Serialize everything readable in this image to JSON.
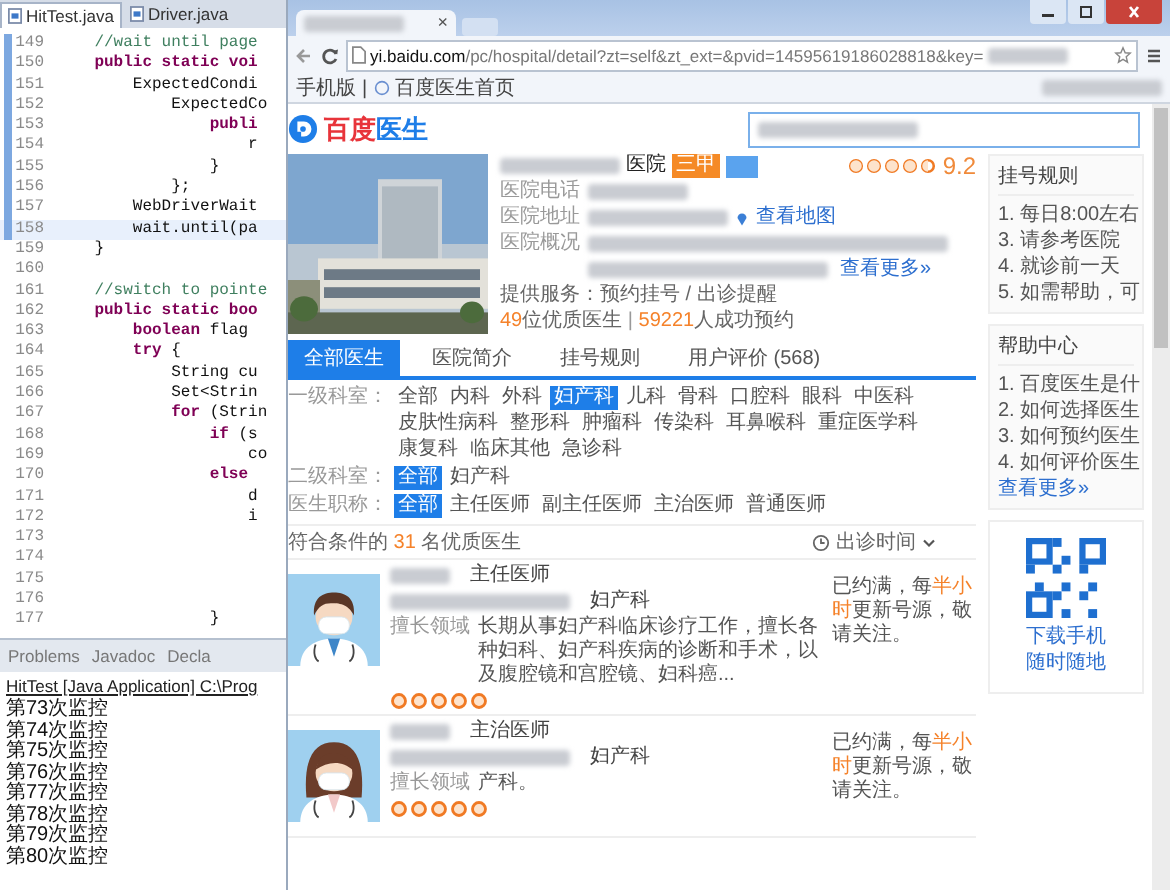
{
  "editor": {
    "tabs": [
      {
        "label": "HitTest.java",
        "selected": true
      },
      {
        "label": "Driver.java",
        "selected": false
      }
    ],
    "lines": [
      {
        "number": "149",
        "current": false,
        "tokens": [
          {
            "text": "    //wait until page",
            "kind": "comment"
          }
        ]
      },
      {
        "number": "150",
        "current": false,
        "tokens": [
          {
            "text": "    public static voi",
            "kind": "keyword"
          }
        ]
      },
      {
        "number": "151",
        "current": false,
        "tokens": [
          {
            "text": "        ExpectedCondi",
            "kind": "plain"
          }
        ]
      },
      {
        "number": "152",
        "current": false,
        "tokens": [
          {
            "text": "            ExpectedCo",
            "kind": "plain"
          }
        ]
      },
      {
        "number": "153",
        "current": false,
        "tokens": [
          {
            "text": "                publi",
            "kind": "keyword"
          }
        ]
      },
      {
        "number": "154",
        "current": false,
        "tokens": [
          {
            "text": "                    r",
            "kind": "plain"
          }
        ]
      },
      {
        "number": "155",
        "current": false,
        "tokens": [
          {
            "text": "                }",
            "kind": "plain"
          }
        ]
      },
      {
        "number": "156",
        "current": false,
        "tokens": [
          {
            "text": "            };",
            "kind": "plain"
          }
        ]
      },
      {
        "number": "157",
        "current": false,
        "tokens": [
          {
            "text": "        WebDriverWait",
            "kind": "plain"
          }
        ]
      },
      {
        "number": "158",
        "current": true,
        "tokens": [
          {
            "text": "        wait.until(pa",
            "kind": "plain"
          }
        ]
      },
      {
        "number": "159",
        "current": false,
        "tokens": [
          {
            "text": "    }",
            "kind": "plain"
          }
        ]
      },
      {
        "number": "160",
        "current": false
      },
      {
        "number": "161",
        "current": false,
        "tokens": [
          {
            "text": "    //switch to pointe",
            "kind": "comment"
          }
        ]
      },
      {
        "number": "162",
        "current": false,
        "tokens": [
          {
            "text": "    public static boo",
            "kind": "keyword"
          }
        ]
      },
      {
        "number": "163",
        "current": false,
        "tokens": [
          {
            "text": "        boolean",
            "kind": "keyword"
          },
          {
            "text": " flag",
            "kind": "plain"
          }
        ]
      },
      {
        "number": "164",
        "current": false,
        "tokens": [
          {
            "text": "        try",
            "kind": "keyword"
          },
          {
            "text": " {",
            "kind": "plain"
          }
        ]
      },
      {
        "number": "165",
        "current": false,
        "tokens": [
          {
            "text": "            String cu",
            "kind": "plain"
          }
        ]
      },
      {
        "number": "166",
        "current": false,
        "tokens": [
          {
            "text": "            Set<Strin",
            "kind": "plain"
          }
        ]
      },
      {
        "number": "167",
        "current": false,
        "tokens": [
          {
            "text": "            for",
            "kind": "keyword"
          },
          {
            "text": " (Strin",
            "kind": "plain"
          }
        ]
      },
      {
        "number": "168",
        "current": false,
        "tokens": [
          {
            "text": "                if",
            "kind": "keyword"
          },
          {
            "text": " (s",
            "kind": "plain"
          }
        ]
      },
      {
        "number": "169",
        "current": false,
        "tokens": [
          {
            "text": "                    co",
            "kind": "plain"
          }
        ]
      },
      {
        "number": "170",
        "current": false,
        "tokens": [
          {
            "text": "                else",
            "kind": "keyword"
          }
        ]
      },
      {
        "number": "171",
        "current": false,
        "tokens": [
          {
            "text": "                    d",
            "kind": "plain"
          }
        ]
      },
      {
        "number": "172",
        "current": false,
        "tokens": [
          {
            "text": "                    i",
            "kind": "plain"
          }
        ]
      },
      {
        "number": "173",
        "current": false
      },
      {
        "number": "174",
        "current": false
      },
      {
        "number": "175",
        "current": false
      },
      {
        "number": "176",
        "current": false
      },
      {
        "number": "177",
        "current": false,
        "tokens": [
          {
            "text": "                }",
            "kind": "plain"
          }
        ]
      }
    ]
  },
  "console": {
    "tabs": [
      "Problems",
      "Javadoc",
      "Decla"
    ],
    "title": "HitTest [Java Application] C:\\Prog",
    "output": [
      "第73次监控",
      "第74次监控",
      "第75次监控",
      "第76次监控",
      "第77次监控",
      "第78次监控",
      "第79次监控",
      "第80次监控"
    ]
  },
  "browser": {
    "tab_close": "×",
    "url": {
      "domain": "yi.baidu.com",
      "path": "/pc/hospital/detail?zt=self&zt_ext=&pvid=14595619186028818&key="
    },
    "bookmarks": [
      "手机版",
      "|",
      "百度医生首页"
    ],
    "logo": {
      "brand": "百度",
      "product": "医生"
    },
    "hospital": {
      "name_suffix": "医院",
      "grade_badge": "三甲",
      "stars": 4.5,
      "score": "9.2",
      "phone_label": "医院电话",
      "address_label": "医院地址",
      "map_link": "查看地图",
      "overview_label": "医院概况",
      "more_link": "查看更多»",
      "services": "提供服务：预约挂号 / 出诊提醒",
      "stats": {
        "doctor_count": "49",
        "doctor_text": "位优质医生",
        "separator": " | ",
        "booking_count": "59221",
        "booking_text": "人成功预约"
      }
    },
    "tabs": [
      {
        "label": "全部医生",
        "selected": true
      },
      {
        "label": "医院简介",
        "selected": false
      },
      {
        "label": "挂号规则",
        "selected": false
      },
      {
        "label": "用户评价 (568)",
        "selected": false
      }
    ],
    "filters": [
      {
        "label": "一级科室：",
        "options": [
          {
            "label": "全部",
            "selected": false
          },
          {
            "label": "内科",
            "selected": false
          },
          {
            "label": "外科",
            "selected": false
          },
          {
            "label": "妇产科",
            "selected": true
          },
          {
            "label": "儿科",
            "selected": false
          },
          {
            "label": "骨科",
            "selected": false
          },
          {
            "label": "口腔科",
            "selected": false
          },
          {
            "label": "眼科",
            "selected": false
          },
          {
            "label": "中医科",
            "selected": false
          },
          {
            "label": "皮肤性病科",
            "selected": false
          },
          {
            "label": "整形科",
            "selected": false
          },
          {
            "label": "肿瘤科",
            "selected": false
          },
          {
            "label": "传染科",
            "selected": false
          },
          {
            "label": "耳鼻喉科",
            "selected": false
          },
          {
            "label": "重症医学科",
            "selected": false
          },
          {
            "label": "康复科",
            "selected": false
          },
          {
            "label": "临床其他",
            "selected": false
          },
          {
            "label": "急诊科",
            "selected": false
          }
        ]
      },
      {
        "label": "二级科室：",
        "options": [
          {
            "label": "全部",
            "selected": true
          },
          {
            "label": "妇产科",
            "selected": false
          }
        ]
      },
      {
        "label": "医生职称：",
        "options": [
          {
            "label": "全部",
            "selected": true
          },
          {
            "label": "主任医师",
            "selected": false
          },
          {
            "label": "副主任医师",
            "selected": false
          },
          {
            "label": "主治医师",
            "selected": false
          },
          {
            "label": "普通医师",
            "selected": false
          }
        ]
      }
    ],
    "results": {
      "prefix": "符合条件的 ",
      "count": "31",
      "suffix": " 名优质医生",
      "sort": "出诊时间"
    },
    "doctors": [
      {
        "kind": "male",
        "title": "主任医师",
        "department": "妇产科",
        "specialty_label": "擅长领域",
        "specialty": "长期从事妇产科临床诊疗工作，擅长各种妇科、妇产科疾病的诊断和手术，以及腹腔镜和宫腔镜、妇科癌...",
        "stars": 5,
        "status": {
          "before": "已约满，每",
          "highlight": "半小时",
          "after": "更新号源，敬请关注。"
        }
      },
      {
        "kind": "female",
        "title": "主治医师",
        "department": "妇产科",
        "specialty_label": "擅长领域",
        "specialty": "产科。",
        "stars": 5,
        "status": {
          "before": "已约满，每",
          "highlight": "半小时",
          "after": "更新号源，敬请关注。"
        }
      }
    ],
    "sidebar": {
      "rules_title": "挂号规则",
      "rules": [
        "1. 每日8:00左右",
        "3. 请参考医院",
        "4. 就诊前一天",
        "5. 如需帮助，可"
      ],
      "help_title": "帮助中心",
      "help": [
        "1. 百度医生是什",
        "2. 如何选择医生",
        "3. 如何预约医生",
        "4. 如何评价医生"
      ],
      "help_more": "查看更多»",
      "app_lines": [
        "下载手机",
        "随时随地"
      ]
    }
  }
}
